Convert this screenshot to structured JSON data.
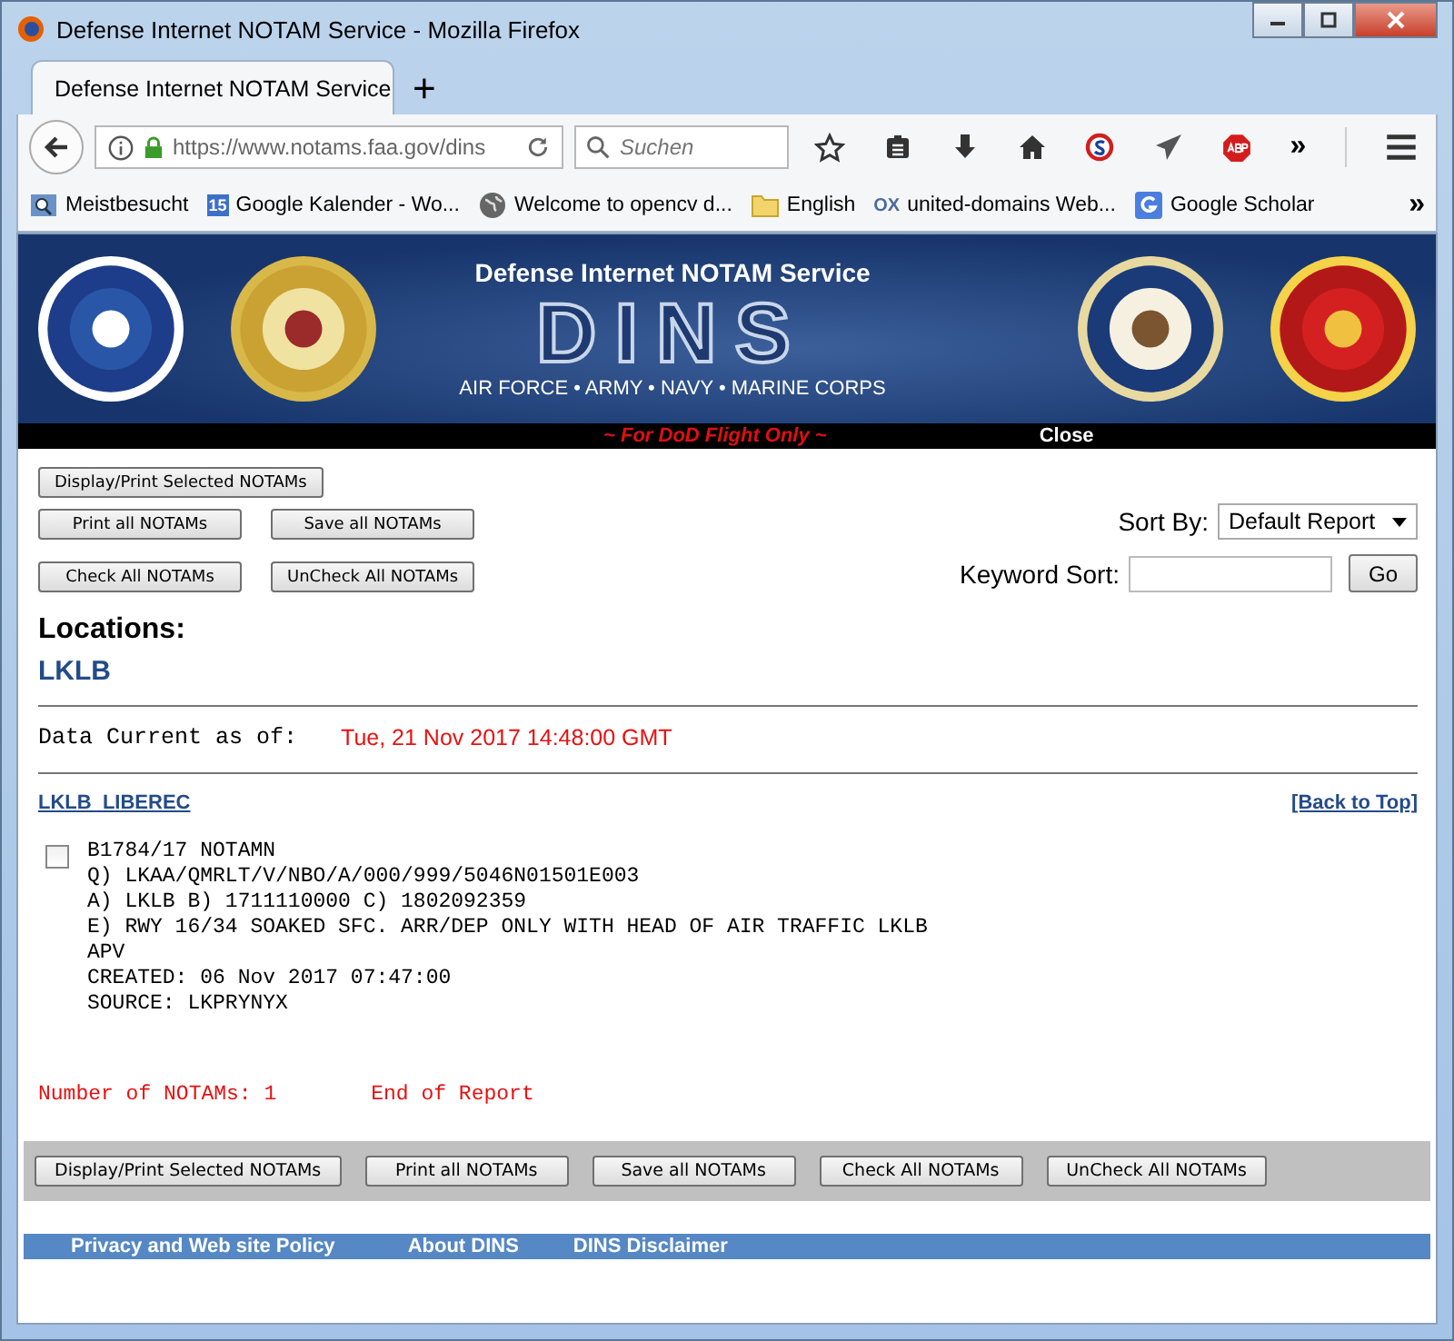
{
  "window": {
    "title": "Defense Internet NOTAM Service - Mozilla Firefox"
  },
  "tabs": [
    {
      "label": "Defense Internet NOTAM Service",
      "selected": true
    }
  ],
  "new_tab_button": "+",
  "address_bar": {
    "url": "https://www.notams.faa.gov/dins"
  },
  "search": {
    "placeholder": "Suchen"
  },
  "toolbar_overflow": "»",
  "bookmarks": [
    {
      "label": "Meistbesucht",
      "kind": "smart"
    },
    {
      "label": "Google Kalender - Wo...",
      "kind": "calendar",
      "icon_text": "15"
    },
    {
      "label": "Welcome to opencv d...",
      "kind": "globe"
    },
    {
      "label": "English",
      "kind": "folder"
    },
    {
      "label": "united-domains Web...",
      "kind": "ox",
      "icon_text": "OX"
    },
    {
      "label": "Google Scholar",
      "kind": "google"
    }
  ],
  "bookmarks_overflow": "»",
  "banner": {
    "title": "Defense Internet NOTAM Service",
    "logo": "DINS",
    "subtitle": "AIR FORCE • ARMY • NAVY • MARINE CORPS",
    "notice": "~ For DoD Flight Only ~",
    "close": "Close"
  },
  "top_button_rows": [
    [
      "Display/Print Selected NOTAMs"
    ],
    [
      "Print all NOTAMs",
      "Save all NOTAMs"
    ],
    [
      "Check All NOTAMs",
      "UnCheck All NOTAMs"
    ]
  ],
  "sort": {
    "label": "Sort By:",
    "value": "Default Report",
    "button": "Go",
    "keyword_label": "Keyword Sort:"
  },
  "locations": {
    "heading": "Locations:",
    "codes": [
      "LKLB"
    ]
  },
  "data_current": {
    "label": "Data Current as of:",
    "value": "Tue, 21 Nov 2017 14:48:00 GMT"
  },
  "airport": {
    "title": "LKLB  LIBEREC",
    "back_to_top": "[Back to Top]"
  },
  "notams": [
    {
      "checked": false,
      "lines": [
        "B1784/17 NOTAMN",
        "Q) LKAA/QMRLT/V/NBO/A/000/999/5046N01501E003",
        "A) LKLB B) 1711110000 C) 1802092359",
        "E) RWY 16/34 SOAKED SFC. ARR/DEP ONLY WITH HEAD OF AIR TRAFFIC LKLB",
        "APV",
        "CREATED: 06 Nov 2017 07:47:00",
        "SOURCE: LKPRYNYX"
      ]
    }
  ],
  "summary": {
    "count": "Number of NOTAMs: 1",
    "end": "End of Report"
  },
  "bottom_buttons": [
    "Display/Print Selected NOTAMs",
    "Print all NOTAMs",
    "Save all NOTAMs",
    "Check All NOTAMs",
    "UnCheck All NOTAMs"
  ],
  "footer_links": [
    "Privacy and Web site Policy",
    "About DINS",
    "DINS Disclaimer"
  ]
}
